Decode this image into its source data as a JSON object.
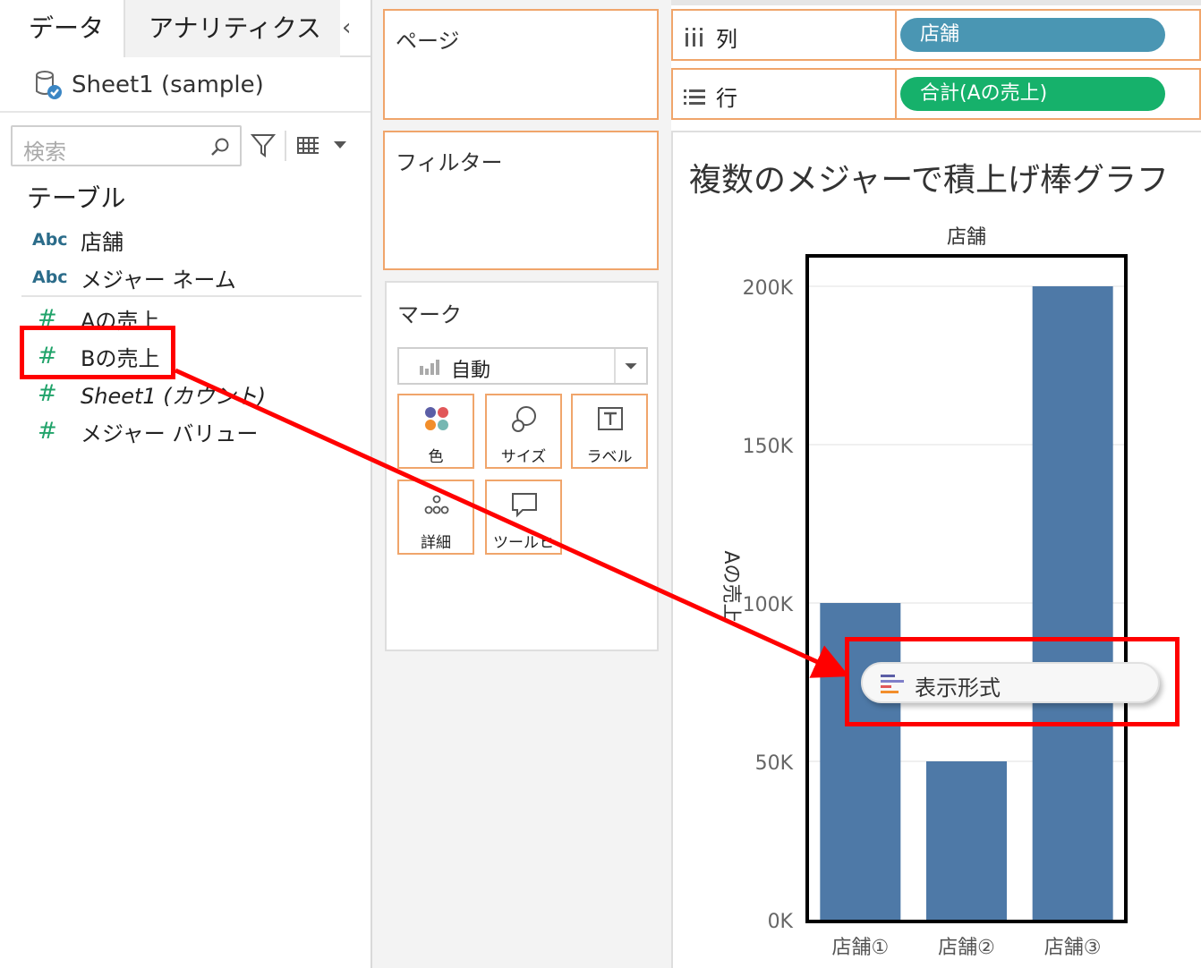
{
  "data_pane": {
    "tabs": [
      "データ",
      "アナリティクス"
    ],
    "datasource": "Sheet1 (sample)",
    "search_placeholder": "検索",
    "table_heading": "テーブル",
    "fields": [
      {
        "type": "Abc",
        "name": "店舗"
      },
      {
        "type": "Abc",
        "name": "メジャー ネーム"
      },
      {
        "type": "#",
        "name": "Aの売上"
      },
      {
        "type": "#",
        "name": "Bの売上"
      },
      {
        "type": "#",
        "name": "Sheet1 (カウント)"
      },
      {
        "type": "#",
        "name": "メジャー バリュー"
      }
    ]
  },
  "cards": {
    "pages": "ページ",
    "filters": "フィルター",
    "marks": "マーク",
    "mark_type": "自動",
    "mark_buttons": [
      "色",
      "サイズ",
      "ラベル",
      "詳細",
      "ツールヒ"
    ]
  },
  "shelves": {
    "columns_label": "列",
    "columns_pill": "店舗",
    "rows_label": "行",
    "rows_pill": "合計(Aの売上)"
  },
  "view": {
    "sheet_title": "複数のメジャーで積上げ棒グラフ"
  },
  "drop_menu": {
    "label": "表示形式"
  },
  "colors": {
    "bar": "#4e79a7",
    "highlight": "#ff0000",
    "shelf_border": "#f0a56b",
    "column_pill": "#4a96b3",
    "row_pill": "#16b16b"
  },
  "chart_data": {
    "type": "bar",
    "title": "",
    "xlabel": "店舗",
    "ylabel": "Aの売上",
    "categories": [
      "店舗①",
      "店舗②",
      "店舗③"
    ],
    "values": [
      100000,
      50000,
      200000
    ],
    "ylim": [
      0,
      200000
    ],
    "yticks": [
      "0K",
      "50K",
      "100K",
      "150K",
      "200K"
    ],
    "ytick_values": [
      0,
      50000,
      100000,
      150000,
      200000
    ],
    "grid": true
  }
}
